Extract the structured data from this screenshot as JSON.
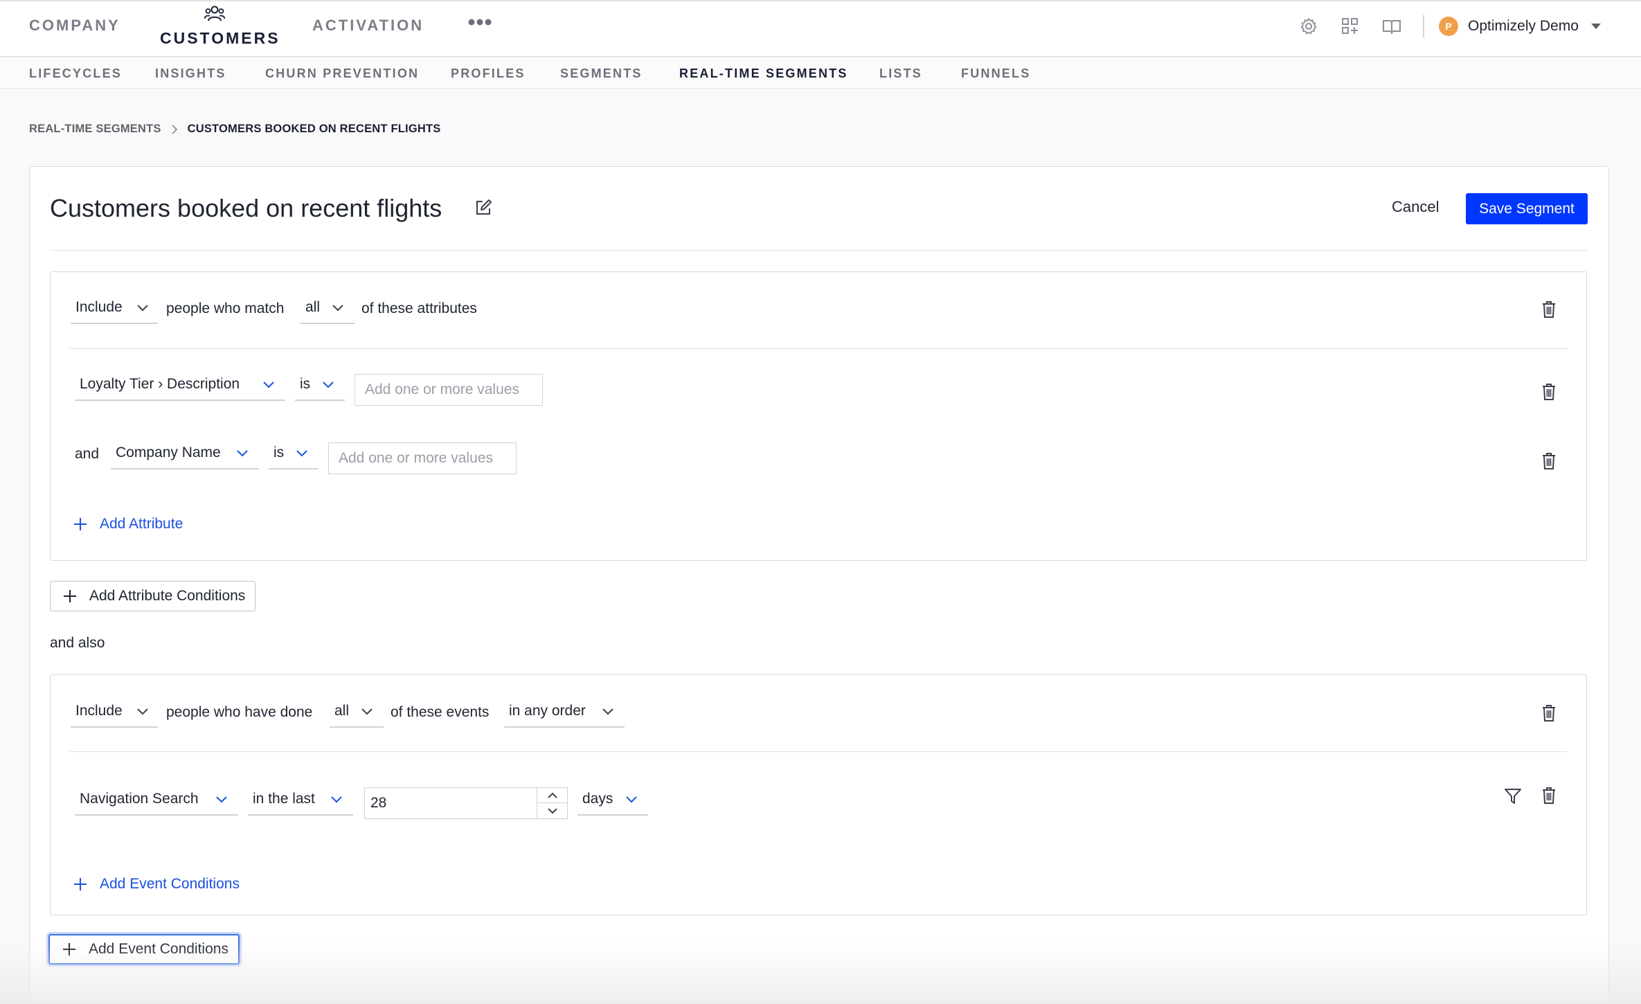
{
  "topnav": {
    "company": "COMPANY",
    "customers": "CUSTOMERS",
    "activation": "ACTIVATION",
    "more_icon": "more-dots-icon"
  },
  "toolbar_icons": [
    "gear-icon",
    "apps-plus-icon",
    "book-icon"
  ],
  "account": {
    "initial": "P",
    "name": "Optimizely Demo",
    "avatar_color": "#f0a04b"
  },
  "subnav": {
    "items": [
      "LIFECYCLES",
      "INSIGHTS",
      "CHURN PREVENTION",
      "PROFILES",
      "SEGMENTS",
      "REAL-TIME SEGMENTS",
      "LISTS",
      "FUNNELS"
    ],
    "active": "REAL-TIME SEGMENTS"
  },
  "breadcrumb": {
    "parent": "REAL-TIME SEGMENTS",
    "current": "CUSTOMERS BOOKED ON RECENT FLIGHTS"
  },
  "header": {
    "title": "Customers booked on recent flights",
    "cancel": "Cancel",
    "save": "Save Segment"
  },
  "attribute_group": {
    "include": "Include",
    "match_text": "people who match",
    "match_mode": "all",
    "suffix": "of these attributes",
    "conditions": [
      {
        "connector": "",
        "field": "Loyalty Tier › Description",
        "operator": "is",
        "placeholder": "Add one or more values"
      },
      {
        "connector": "and",
        "field": "Company Name",
        "operator": "is",
        "placeholder": "Add one or more values"
      }
    ],
    "add_attribute": "Add Attribute"
  },
  "add_attribute_conditions": "Add Attribute Conditions",
  "and_also": "and also",
  "event_group": {
    "include": "Include",
    "done_text": "people who have done",
    "match_mode": "all",
    "events_text": "of these events",
    "order": "in any order",
    "event": {
      "name": "Navigation Search",
      "window": "in the last",
      "value": "28",
      "unit": "days"
    },
    "add_event_conditions": "Add Event Conditions"
  },
  "add_event_conditions_outer": "Add Event Conditions",
  "colors": {
    "primary": "#0037ff",
    "link": "#1a4fe0",
    "text": "#1f2430"
  }
}
